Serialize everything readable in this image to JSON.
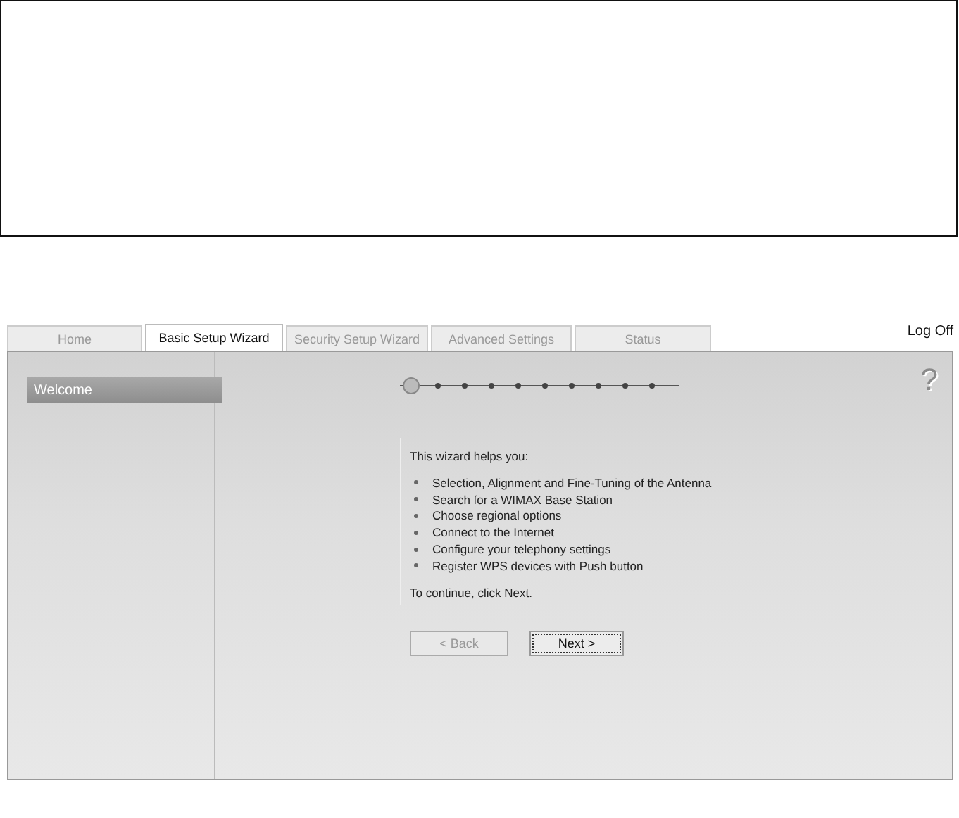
{
  "tabs": [
    {
      "label": "Home",
      "selected": false
    },
    {
      "label": "Basic Setup Wizard",
      "selected": true
    },
    {
      "label": "Security Setup Wizard",
      "selected": false
    },
    {
      "label": "Advanced Settings",
      "selected": false
    },
    {
      "label": "Status",
      "selected": false
    }
  ],
  "logoff": "Log Off",
  "sidebar": {
    "items": [
      {
        "label": "Welcome",
        "selected": true
      }
    ]
  },
  "steps": [
    {
      "selected": true
    },
    {
      "selected": false
    },
    {
      "selected": false
    },
    {
      "selected": false
    },
    {
      "selected": false
    },
    {
      "selected": false
    },
    {
      "selected": false
    },
    {
      "selected": false
    },
    {
      "selected": false
    },
    {
      "selected": false
    }
  ],
  "help": "?",
  "intro": "This wizard helps you:",
  "bullets": [
    "Selection, Alignment and Fine-Tuning of the Antenna",
    "Search for a WIMAX Base Station",
    "Choose regional options",
    "Connect to the Internet",
    "Configure your telephony settings",
    "Register WPS devices with Push button"
  ],
  "outro": "To continue, click Next.",
  "buttons": [
    {
      "label": "< Back",
      "disabled": true
    },
    {
      "label": "Next >",
      "disabled": false
    }
  ]
}
